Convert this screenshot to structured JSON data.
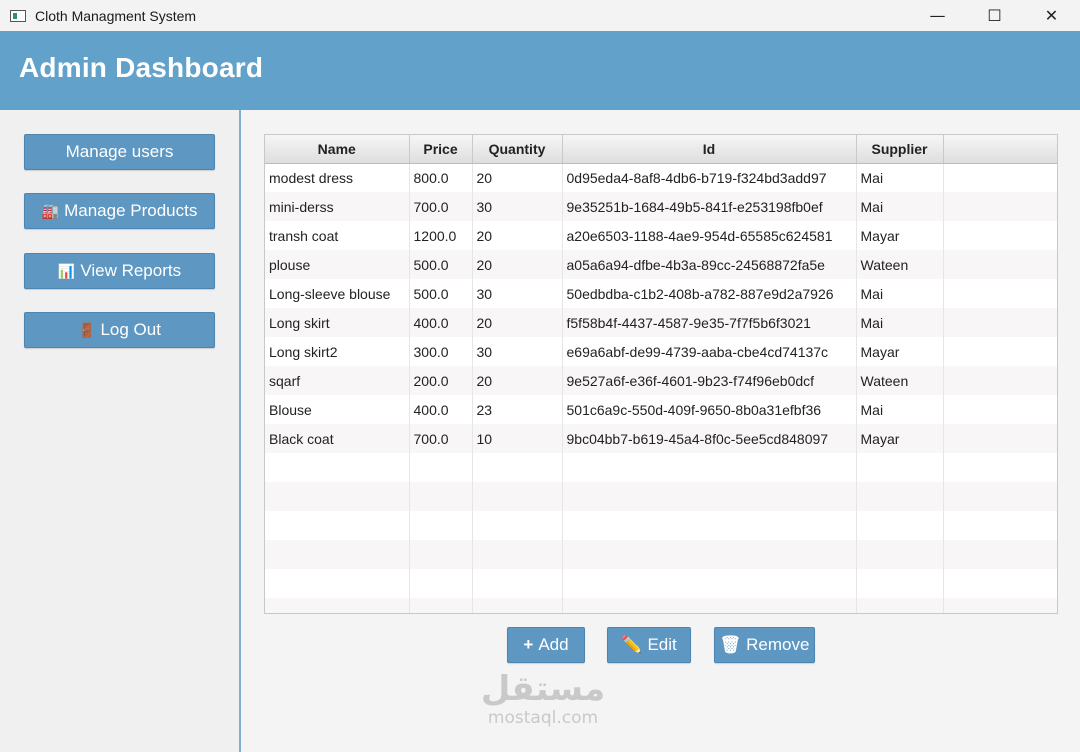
{
  "window": {
    "title": "Cloth Managment System",
    "controls": {
      "minimize": "—",
      "maximize": "☐",
      "close": "✕"
    }
  },
  "header": {
    "title": "Admin Dashboard"
  },
  "sidebar": {
    "items": [
      {
        "label": "Manage users",
        "icon": ""
      },
      {
        "label": "Manage Products",
        "icon": "🏭"
      },
      {
        "label": "View Reports",
        "icon": "📊"
      },
      {
        "label": "Log Out",
        "icon": "🚪"
      }
    ]
  },
  "table": {
    "columns": [
      "Name",
      "Price",
      "Quantity",
      "Id",
      "Supplier"
    ],
    "rows": [
      [
        "modest dress",
        "800.0",
        "20",
        "0d95eda4-8af8-4db6-b719-f324bd3add97",
        "Mai"
      ],
      [
        "mini-derss",
        "700.0",
        "30",
        "9e35251b-1684-49b5-841f-e253198fb0ef",
        "Mai"
      ],
      [
        "transh coat",
        "1200.0",
        "20",
        "a20e6503-1188-4ae9-954d-65585c624581",
        "Mayar"
      ],
      [
        "plouse",
        "500.0",
        "20",
        "a05a6a94-dfbe-4b3a-89cc-24568872fa5e",
        "Wateen"
      ],
      [
        "Long-sleeve blouse",
        "500.0",
        "30",
        "50edbdba-c1b2-408b-a782-887e9d2a7926",
        "Mai"
      ],
      [
        "Long skirt",
        "400.0",
        "20",
        "f5f58b4f-4437-4587-9e35-7f7f5b6f3021",
        "Mai"
      ],
      [
        "Long skirt2",
        "300.0",
        "30",
        "e69a6abf-de99-4739-aaba-cbe4cd74137c",
        "Mayar"
      ],
      [
        "sqarf",
        "200.0",
        "20",
        "9e527a6f-e36f-4601-9b23-f74f96eb0dcf",
        "Wateen"
      ],
      [
        "Blouse",
        "400.0",
        "23",
        "501c6a9c-550d-409f-9650-8b0a31efbf36",
        "Mai"
      ],
      [
        "Black coat",
        "700.0",
        "10",
        "9bc04bb7-b619-45a4-8f0c-5ee5cd848097",
        "Mayar"
      ]
    ],
    "empty_rows": 6
  },
  "actions": {
    "add": {
      "label": "Add",
      "icon": "+"
    },
    "edit": {
      "label": "Edit",
      "icon": "✏️"
    },
    "remove": {
      "label": "Remove",
      "icon": "🗑"
    }
  },
  "watermark": {
    "arabic": "مستقل",
    "latin": "mostaql.com"
  },
  "colors": {
    "accent": "#5d97c2",
    "header": "#62a1c9"
  }
}
